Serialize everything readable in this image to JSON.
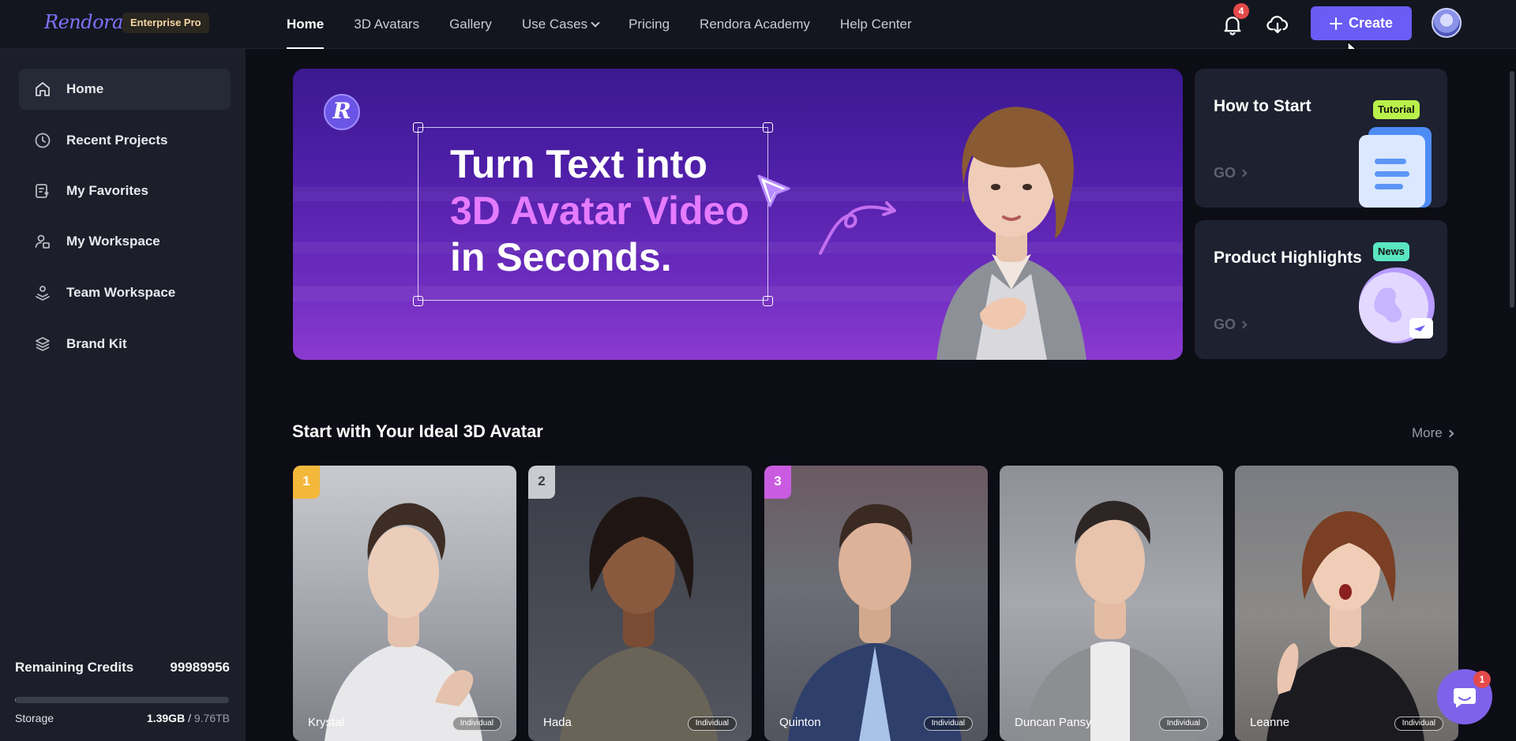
{
  "brand": {
    "logo": "Rendora",
    "plan": "Enterprise Pro"
  },
  "nav": [
    {
      "label": "Home"
    },
    {
      "label": "3D Avatars"
    },
    {
      "label": "Gallery"
    },
    {
      "label": "Use Cases"
    },
    {
      "label": "Pricing"
    },
    {
      "label": "Rendora Academy"
    },
    {
      "label": "Help Center"
    }
  ],
  "header": {
    "notification_count": "4",
    "create_label": "Create"
  },
  "sidebar": {
    "items": [
      {
        "label": "Home",
        "icon": "home-icon"
      },
      {
        "label": "Recent Projects",
        "icon": "clock-icon"
      },
      {
        "label": "My Favorites",
        "icon": "favorites-icon"
      },
      {
        "label": "My Workspace",
        "icon": "workspace-icon"
      },
      {
        "label": "Team Workspace",
        "icon": "team-icon"
      },
      {
        "label": "Brand Kit",
        "icon": "layers-icon"
      }
    ],
    "credits_label": "Remaining Credits",
    "credits_value": "99989956",
    "storage_label": "Storage",
    "storage_used": "1.39GB",
    "storage_total": "9.76TB",
    "storage_fraction": 0.0001
  },
  "banner": {
    "line1": "Turn Text into",
    "line2": "3D Avatar Video",
    "line3": "in Seconds.",
    "logo_letter": "R"
  },
  "cards": {
    "how_to_start": {
      "title": "How to Start",
      "go": "GO",
      "tag": "Tutorial"
    },
    "product_highlights": {
      "title": "Product Highlights",
      "go": "GO",
      "tag": "News"
    }
  },
  "section": {
    "title": "Start with Your Ideal 3D Avatar",
    "more": "More"
  },
  "avatars": [
    {
      "rank": "1",
      "name": "Krystal",
      "tag": "Individual"
    },
    {
      "rank": "2",
      "name": "Hada",
      "tag": "Individual"
    },
    {
      "rank": "3",
      "name": "Quinton",
      "tag": "Individual"
    },
    {
      "rank": "",
      "name": "Duncan Pansy",
      "tag": "Individual"
    },
    {
      "rank": "",
      "name": "Leanne",
      "tag": "Individual"
    }
  ],
  "chat": {
    "badge": "1"
  },
  "colors": {
    "accent": "#6a5cf5",
    "highlight_text": "#e57bff",
    "tag_green": "#b9f04a",
    "badge_red": "#e44a4a"
  }
}
